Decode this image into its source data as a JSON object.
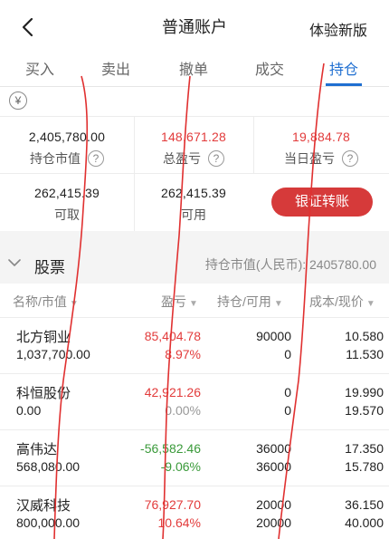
{
  "header": {
    "title": "普通账户",
    "experience_label": "体验新版"
  },
  "tabs": [
    {
      "label": "买入",
      "active": false
    },
    {
      "label": "卖出",
      "active": false
    },
    {
      "label": "撤单",
      "active": false
    },
    {
      "label": "成交",
      "active": false
    },
    {
      "label": "持仓",
      "active": true
    }
  ],
  "currency_symbol": "¥",
  "summary": {
    "position_value": {
      "value": "2,405,780.00",
      "label": "持仓市值"
    },
    "total_pl": {
      "value": "148,671.28",
      "label": "总盈亏"
    },
    "today_pl": {
      "value": "19,884.78",
      "label": "当日盈亏"
    },
    "withdrawable": {
      "value": "262,415.39",
      "label": "可取"
    },
    "available": {
      "value": "262,415.39",
      "label": "可用"
    },
    "transfer_button": "银证转账",
    "help_mark": "?"
  },
  "stock_section": {
    "title": "股票",
    "market_value_text": "持仓市值(人民币): 2405780.00"
  },
  "columns": {
    "name_mv": "名称/市值",
    "pl": "盈亏",
    "hold_avail": "持仓/可用",
    "cost_price": "成本/现价",
    "sort_glyph": "▼"
  },
  "positions": [
    {
      "name": "北方铜业",
      "market_value": "1,037,700.00",
      "pl": "85,404.78",
      "pl_pct": "8.97%",
      "pl_color": "red",
      "pct_color": "red",
      "hold": "90000",
      "avail": "0",
      "cost": "10.580",
      "price": "11.530"
    },
    {
      "name": "科恒股份",
      "market_value": "0.00",
      "pl": "42,921.26",
      "pl_pct": "0.00%",
      "pl_color": "red",
      "pct_color": "grey",
      "hold": "0",
      "avail": "0",
      "cost": "19.990",
      "price": "19.570"
    },
    {
      "name": "高伟达",
      "market_value": "568,080.00",
      "pl": "-56,582.46",
      "pl_pct": "-9.06%",
      "pl_color": "green",
      "pct_color": "green",
      "hold": "36000",
      "avail": "36000",
      "cost": "17.350",
      "price": "15.780"
    },
    {
      "name": "汉威科技",
      "market_value": "800,000.00",
      "pl": "76,927.70",
      "pl_pct": "10.64%",
      "pl_color": "red",
      "pct_color": "red",
      "hold": "20000",
      "avail": "20000",
      "cost": "36.150",
      "price": "40.000"
    }
  ],
  "colors": {
    "accent": "#1f6fd1",
    "profit": "#e23b3b",
    "loss": "#3a9a3a",
    "button": "#d63a3a",
    "annotation": "#e03030"
  }
}
